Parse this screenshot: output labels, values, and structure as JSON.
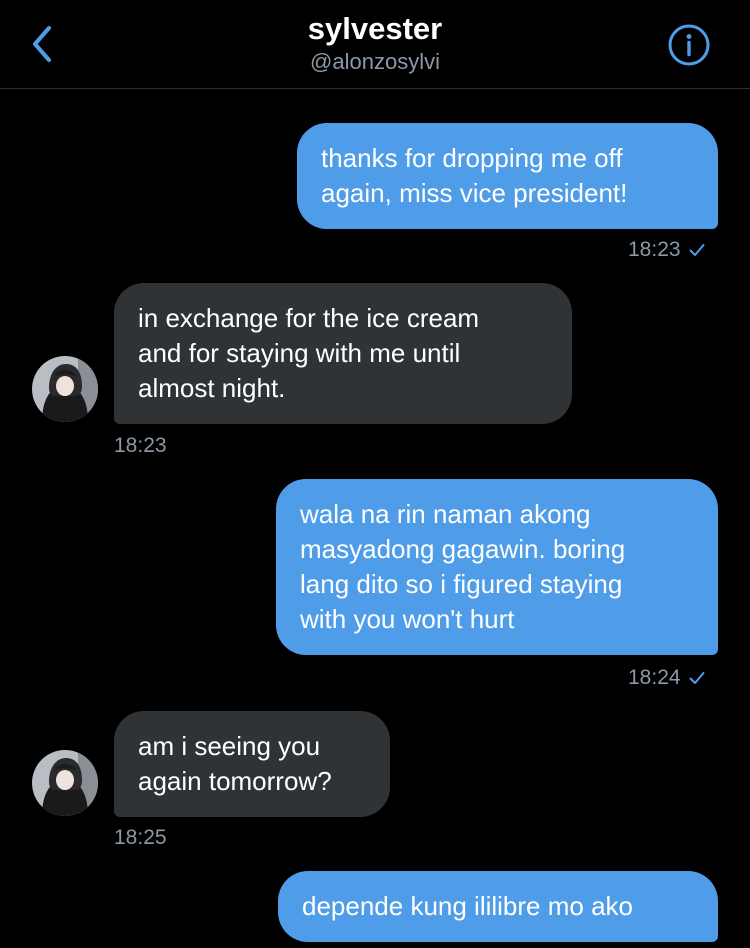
{
  "header": {
    "title": "sylvester",
    "handle": "@alonzosylvi",
    "icons": [
      "chevron-left-icon",
      "info-icon"
    ],
    "accent_color": "#4f9de8"
  },
  "messages": [
    {
      "direction": "outgoing",
      "text_lines": [
        "thanks for dropping me off",
        "again, miss vice president!"
      ],
      "time": "18:23",
      "read_icon": "check-icon"
    },
    {
      "direction": "incoming",
      "text_lines": [
        "in exchange for the ice cream",
        "and for staying with me until",
        "almost night."
      ],
      "time": "18:23"
    },
    {
      "direction": "outgoing",
      "text_lines": [
        "wala na rin naman akong",
        "masyadong gagawin. boring",
        "lang dito so i figured staying",
        "with you won't hurt"
      ],
      "time": "18:24",
      "read_icon": "check-icon"
    },
    {
      "direction": "incoming",
      "text_lines": [
        "am i seeing you",
        "again tomorrow?"
      ],
      "time": "18:25"
    },
    {
      "direction": "outgoing",
      "text_lines": [
        "depende kung ililibre mo ako"
      ]
    }
  ],
  "colors": {
    "outgoing_bubble": "#4f9de8",
    "incoming_bubble": "#2f3336",
    "background": "#000000",
    "muted_text": "#8b98a5"
  }
}
